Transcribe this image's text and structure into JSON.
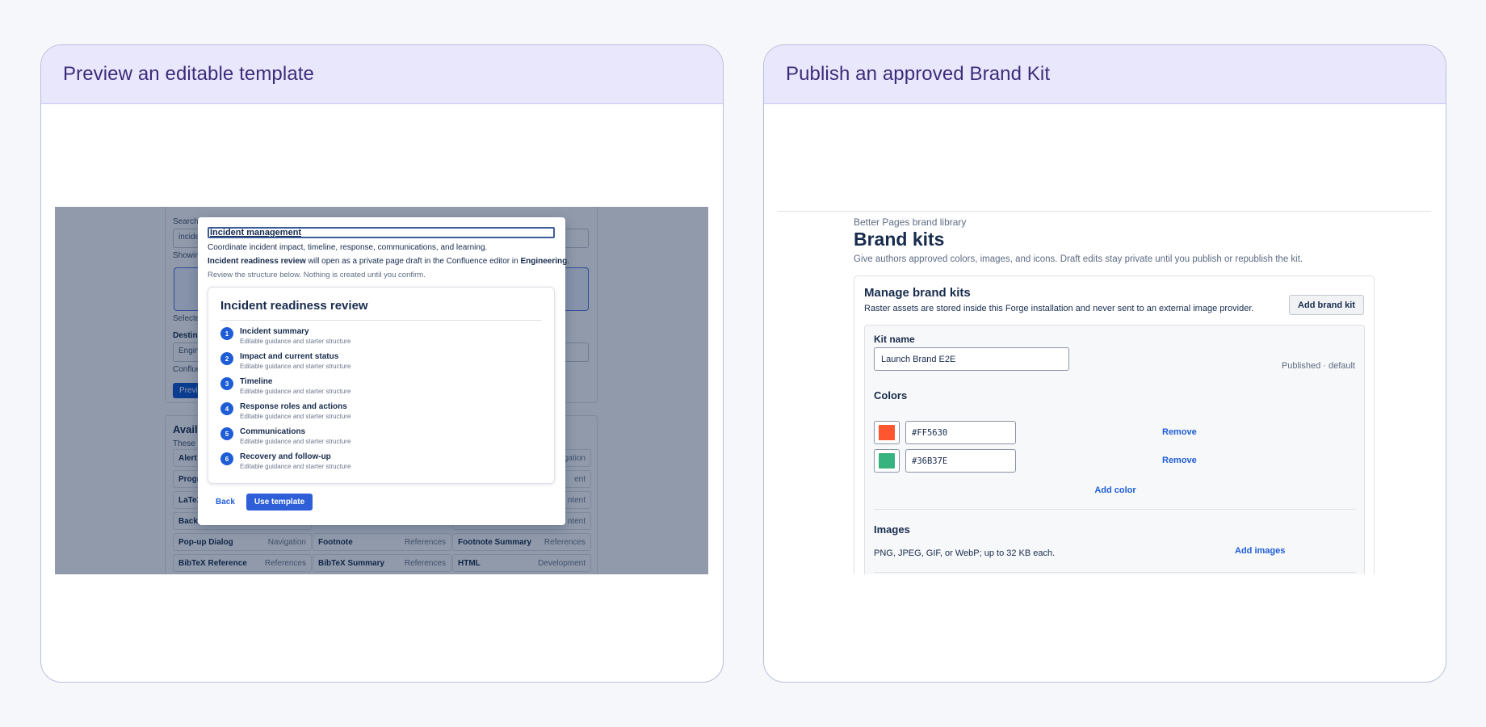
{
  "left_card": {
    "title": "Preview an editable template",
    "background": {
      "search_label": "Search",
      "search_value": "incide",
      "showing_label": "Showin",
      "selected_label": "Selecte",
      "destination_label": "Destina",
      "destination_value": "Engin",
      "confluence_label": "Conflue",
      "preview_button": "Previ",
      "available_heading": "Availa",
      "available_sub": "These a",
      "macros": [
        {
          "name": "Alert",
          "category": "gation"
        },
        {
          "name": "Progr",
          "category": "ent"
        },
        {
          "name": "LaTeX",
          "category": "ntent"
        },
        {
          "name": "Backg",
          "category": "ntent"
        },
        {
          "name": "Pop-up Dialog",
          "category": "Navigation"
        },
        {
          "name": "Footnote",
          "category": "References"
        },
        {
          "name": "Footnote Summary",
          "category": "References"
        },
        {
          "name": "BibTeX Reference",
          "category": "References"
        },
        {
          "name": "BibTeX Summary",
          "category": "References"
        },
        {
          "name": "HTML",
          "category": "Development"
        }
      ]
    },
    "modal": {
      "title_value": "Incident management",
      "description": "Coordinate incident impact, timeline, response, communications, and learning.",
      "note_page": "Incident readiness review",
      "note_middle": " will open as a private page draft in the Confluence editor in ",
      "note_space": "Engineering",
      "note_end": ".",
      "hint": "Review the structure below. Nothing is created until you confirm.",
      "preview_title": "Incident readiness review",
      "steps": [
        {
          "num": "1",
          "title": "Incident summary",
          "sub": "Editable guidance and starter structure"
        },
        {
          "num": "2",
          "title": "Impact and current status",
          "sub": "Editable guidance and starter structure"
        },
        {
          "num": "3",
          "title": "Timeline",
          "sub": "Editable guidance and starter structure"
        },
        {
          "num": "4",
          "title": "Response roles and actions",
          "sub": "Editable guidance and starter structure"
        },
        {
          "num": "5",
          "title": "Communications",
          "sub": "Editable guidance and starter structure"
        },
        {
          "num": "6",
          "title": "Recovery and follow-up",
          "sub": "Editable guidance and starter structure"
        }
      ],
      "back_label": "Back",
      "use_label": "Use template"
    }
  },
  "right_card": {
    "title": "Publish an approved Brand Kit",
    "breadcrumb": "Better Pages brand library",
    "heading": "Brand kits",
    "subheading": "Give authors approved colors, images, and icons. Draft edits stay private until you publish or republish the kit.",
    "panel": {
      "heading": "Manage brand kits",
      "description": "Raster assets are stored inside this Forge installation and never sent to an external image provider.",
      "add_kit_label": "Add brand kit",
      "kit_name_label": "Kit name",
      "kit_name_value": "Launch Brand E2E",
      "status": "Published · default",
      "colors_heading": "Colors",
      "colors": [
        {
          "hex": "#FF5630",
          "swatch": "#FF5630",
          "remove_label": "Remove"
        },
        {
          "hex": "#36B37E",
          "swatch": "#36B37E",
          "remove_label": "Remove"
        }
      ],
      "add_color_label": "Add color",
      "images_heading": "Images",
      "images_description": "PNG, JPEG, GIF, or WebP; up to 32 KB each.",
      "add_images_label": "Add images"
    }
  }
}
